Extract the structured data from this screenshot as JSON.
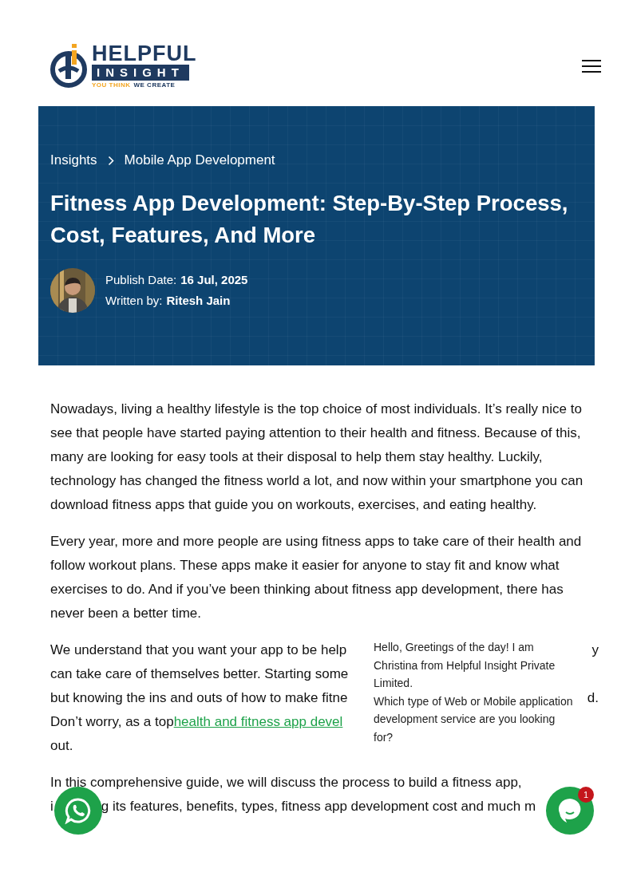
{
  "header": {
    "logo": {
      "word_top": "HELPFUL",
      "word_bottom": "INSIGHT",
      "tagline_first": "YOU THINK",
      "tagline_second": "WE CREATE"
    }
  },
  "hero": {
    "breadcrumbs": [
      {
        "label": "Insights"
      },
      {
        "label": "Mobile App Development"
      }
    ],
    "title": "Fitness App Development: Step-By-Step Process, Cost, Features, And More",
    "meta": [
      {
        "label": "Publish Date:",
        "value": "16 Jul, 2025"
      },
      {
        "label": "Written by:",
        "value": "Ritesh Jain"
      }
    ]
  },
  "article": {
    "paragraphs": [
      {
        "kind": "text",
        "text": "Nowadays, living a healthy lifestyle is the top choice of most individuals. It’s really nice to see that people have started paying attention to their health and fitness. Because of this, many are looking for easy tools at their disposal to help them stay healthy. Luckily, technology has changed the fitness world a lot, and now within your smartphone you can download fitness apps that guide you on workouts, exercises, and eating healthy."
      },
      {
        "kind": "text",
        "text": "Every year, more and more people are using fitness apps to take care of their health and follow workout plans. These apps make it easier for anyone to stay fit and know what exercises to do. And if you’ve been thinking about fitness app development, there has never been a better time."
      },
      {
        "kind": "lines",
        "lines": [
          {
            "parts": [
              {
                "kind": "text",
                "text": "We understand that you want your app to be help"
              }
            ],
            "trailing": "y"
          },
          {
            "parts": [
              {
                "kind": "text",
                "text": "can take care of themselves better. Starting some"
              }
            ]
          },
          {
            "parts": [
              {
                "kind": "text",
                "text": "but knowing the ins and outs of how to make fitne"
              }
            ],
            "trailing": "d."
          },
          {
            "parts": [
              {
                "kind": "text",
                "text": "Don’t worry, as a top "
              },
              {
                "kind": "link",
                "text": "health and fitness app devel"
              }
            ]
          },
          {
            "parts": [
              {
                "kind": "text",
                "text": "out."
              }
            ]
          }
        ]
      },
      {
        "kind": "lines",
        "lines": [
          {
            "parts": [
              {
                "kind": "text",
                "text": "In this comprehensive guide, we will discuss the process to build a fitness app,"
              }
            ]
          },
          {
            "parts": [
              {
                "kind": "text",
                "text": "i"
              },
              {
                "kind": "text",
                "text": "g its features, benefits, types, fitness app development cost and much m"
              }
            ]
          }
        ]
      }
    ]
  },
  "chat_popup": {
    "lines": [
      "Hello, Greetings of the day! I am Christina from Helpful Insight Private Limited.",
      "Which type of Web or Mobile application development service are you looking for?"
    ]
  },
  "chat_button": {
    "badge": "1"
  }
}
